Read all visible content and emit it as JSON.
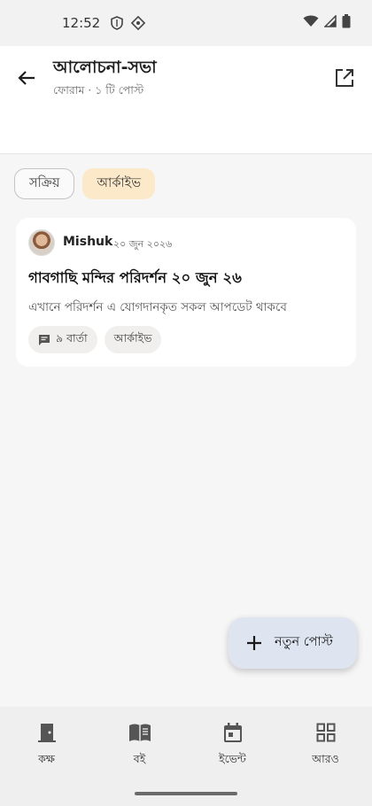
{
  "status_bar": {
    "time": "12:52"
  },
  "header": {
    "title": "আলোচনা-সভা",
    "subtitle": "ফোরাম · ১ টি পোস্ট"
  },
  "filters": {
    "active_label": "সক্রিয়",
    "archive_label": "আর্কাইভ"
  },
  "post": {
    "author": "Mishuk",
    "date": "২০ জুন ২০২৬",
    "title": "গাবগাছি মন্দির পরিদর্শন ২০ জুন ২৬",
    "description": "এখানে পরিদর্শন এ যোগদানকৃত সকল আপডেট থাকবে",
    "messages_label": "৯ বার্তা",
    "status_tag": "আর্কাইভ"
  },
  "fab": {
    "label": "নতুন পোস্ট"
  },
  "bottom_nav": {
    "items": [
      {
        "label": "কক্ষ",
        "icon": "door-icon"
      },
      {
        "label": "বই",
        "icon": "book-icon"
      },
      {
        "label": "ইভেন্ট",
        "icon": "calendar-icon"
      },
      {
        "label": "আরও",
        "icon": "grid-icon"
      }
    ]
  },
  "colors": {
    "archive_chip": "#fbe9c9",
    "fab_background": "#dfe4f1"
  }
}
